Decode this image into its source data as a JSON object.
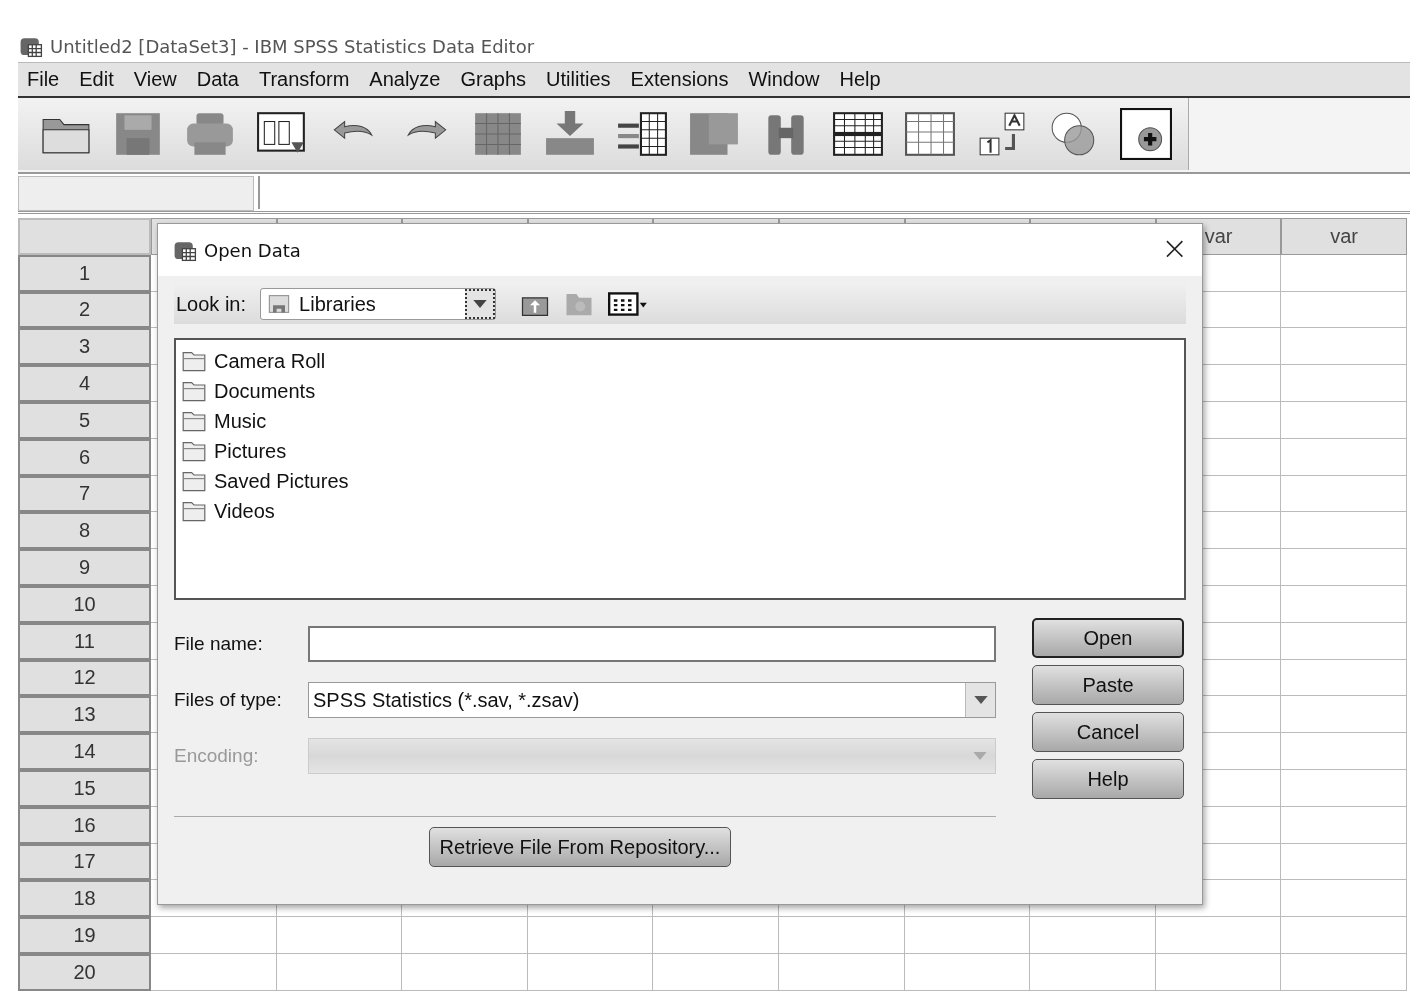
{
  "window": {
    "title": "Untitled2 [DataSet3] - IBM SPSS Statistics Data Editor"
  },
  "menu": [
    "File",
    "Edit",
    "View",
    "Data",
    "Transform",
    "Analyze",
    "Graphs",
    "Utilities",
    "Extensions",
    "Window",
    "Help"
  ],
  "grid": {
    "visible_headers": [
      "var",
      "var"
    ],
    "rows": [
      "1",
      "2",
      "3",
      "4",
      "5",
      "6",
      "7",
      "8",
      "9",
      "10",
      "11",
      "12",
      "13",
      "14",
      "15",
      "16",
      "17",
      "18",
      "19",
      "20"
    ]
  },
  "dialog": {
    "title": "Open Data",
    "close": "×",
    "look_in": {
      "label": "Look in:",
      "value": "Libraries"
    },
    "files": [
      "Camera Roll",
      "Documents",
      "Music",
      "Pictures",
      "Saved Pictures",
      "Videos"
    ],
    "file_name": {
      "label": "File name:"
    },
    "file_type": {
      "label": "Files of type:",
      "value": "SPSS Statistics (*.sav, *.zsav)"
    },
    "encoding": {
      "label": "Encoding:",
      "disabled": true
    },
    "buttons": [
      {
        "label": "Open",
        "default": true
      },
      {
        "label": "Paste",
        "default": false
      },
      {
        "label": "Cancel",
        "default": false
      },
      {
        "label": "Help",
        "default": false
      }
    ],
    "repository_button": "Retrieve File From Repository..."
  }
}
